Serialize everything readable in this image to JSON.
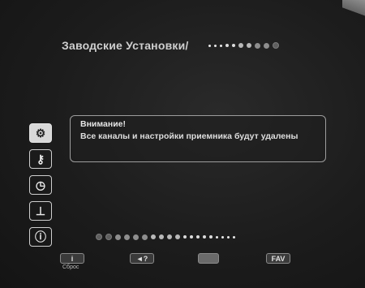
{
  "header": {
    "title": "Заводские Установки/"
  },
  "sidebar": {
    "items": [
      {
        "icon": "satellite-dish-icon",
        "glyph": "⚙",
        "active": true
      },
      {
        "icon": "key-icon",
        "glyph": "⚷",
        "active": false
      },
      {
        "icon": "clock-icon",
        "glyph": "◷",
        "active": false
      },
      {
        "icon": "layout-icon",
        "glyph": "⊥",
        "active": false
      },
      {
        "icon": "info-icon",
        "glyph": "ⓘ",
        "active": false
      }
    ]
  },
  "dialog": {
    "heading": "Внимание!",
    "message": "Все каналы и настройки приемника будут удалены"
  },
  "footer": {
    "info_caption": "Сброс",
    "audio_label": "◄?",
    "fav_label": "FAV"
  }
}
